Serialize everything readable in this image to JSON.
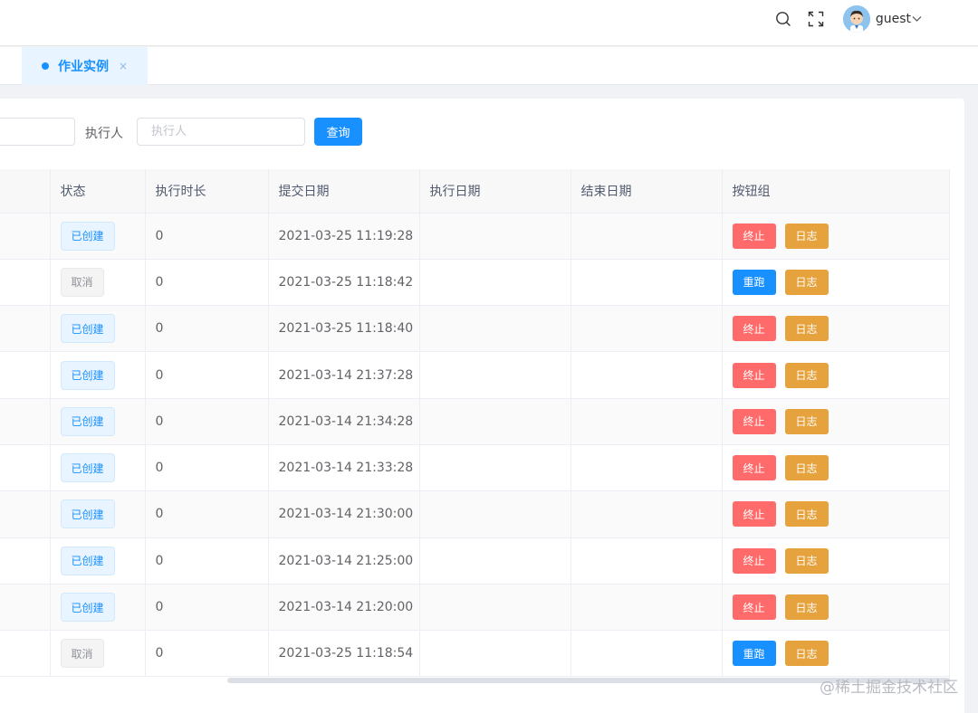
{
  "header": {
    "username": "guest",
    "icons": [
      "search-icon",
      "fullscreen-icon",
      "avatar",
      "chevron-down-icon"
    ]
  },
  "tabs": [
    {
      "label": "作业实例",
      "active": true,
      "close": "×"
    }
  ],
  "filters": {
    "executor_label": "执行人",
    "executor_placeholder": "执行人",
    "search_button": "查询"
  },
  "table": {
    "columns": [
      "",
      "状态",
      "执行时长",
      "提交日期",
      "执行日期",
      "结束日期",
      "按钮组"
    ],
    "rows": [
      {
        "status": "已创建",
        "status_type": "created",
        "duration": "0",
        "submit": "2021-03-25 11:19:28",
        "exec": "",
        "end": "",
        "action": "终止",
        "log": "日志"
      },
      {
        "status": "取消",
        "status_type": "cancel",
        "duration": "0",
        "submit": "2021-03-25 11:18:42",
        "exec": "",
        "end": "",
        "action": "重跑",
        "log": "日志"
      },
      {
        "status": "已创建",
        "status_type": "created",
        "duration": "0",
        "submit": "2021-03-25 11:18:40",
        "exec": "",
        "end": "",
        "action": "终止",
        "log": "日志"
      },
      {
        "status": "已创建",
        "status_type": "created",
        "duration": "0",
        "submit": "2021-03-14 21:37:28",
        "exec": "",
        "end": "",
        "action": "终止",
        "log": "日志"
      },
      {
        "status": "已创建",
        "status_type": "created",
        "duration": "0",
        "submit": "2021-03-14 21:34:28",
        "exec": "",
        "end": "",
        "action": "终止",
        "log": "日志"
      },
      {
        "status": "已创建",
        "status_type": "created",
        "duration": "0",
        "submit": "2021-03-14 21:33:28",
        "exec": "",
        "end": "",
        "action": "终止",
        "log": "日志"
      },
      {
        "status": "已创建",
        "status_type": "created",
        "duration": "0",
        "submit": "2021-03-14 21:30:00",
        "exec": "",
        "end": "",
        "action": "终止",
        "log": "日志"
      },
      {
        "status": "已创建",
        "status_type": "created",
        "duration": "0",
        "submit": "2021-03-14 21:25:00",
        "exec": "",
        "end": "",
        "action": "终止",
        "log": "日志"
      },
      {
        "status": "已创建",
        "status_type": "created",
        "duration": "0",
        "submit": "2021-03-14 21:20:00",
        "exec": "",
        "end": "",
        "action": "终止",
        "log": "日志"
      },
      {
        "status": "取消",
        "status_type": "cancel",
        "duration": "0",
        "submit": "2021-03-25 11:18:54",
        "exec": "",
        "end": "",
        "action": "重跑",
        "log": "日志"
      }
    ]
  },
  "watermark": "@稀土掘金技术社区",
  "colors": {
    "primary": "#1890ff",
    "danger": "#ff6b6b",
    "warning": "#e6a23c"
  }
}
